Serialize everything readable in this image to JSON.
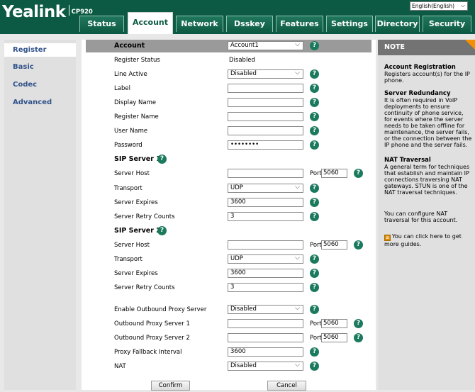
{
  "header": {
    "brand": "Yealink",
    "model": "CP920",
    "language": "English(English)"
  },
  "tabs": [
    "Status",
    "Account",
    "Network",
    "Dsskey",
    "Features",
    "Settings",
    "Directory",
    "Security"
  ],
  "active_tab": "Account",
  "sidebar": {
    "items": [
      {
        "label": "Register"
      },
      {
        "label": "Basic"
      },
      {
        "label": "Codec"
      },
      {
        "label": "Advanced"
      }
    ]
  },
  "form": {
    "account_label": "Account",
    "account_value": "Account1",
    "register_status_label": "Register Status",
    "register_status_value": "Disabled",
    "line_active_label": "Line Active",
    "line_active_value": "Disabled",
    "label_label": "Label",
    "label_value": "",
    "display_name_label": "Display Name",
    "display_name_value": "",
    "register_name_label": "Register Name",
    "register_name_value": "",
    "user_name_label": "User Name",
    "user_name_value": "",
    "password_label": "Password",
    "password_value": "••••••••",
    "sip_server_1": {
      "title": "SIP Server 1",
      "host_label": "Server Host",
      "host_value": "",
      "port_label": "Port",
      "port_value": "5060",
      "transport_label": "Transport",
      "transport_value": "UDP",
      "expires_label": "Server Expires",
      "expires_value": "3600",
      "retry_label": "Server Retry Counts",
      "retry_value": "3"
    },
    "sip_server_2": {
      "title": "SIP Server 2",
      "host_label": "Server Host",
      "host_value": "",
      "port_label": "Port",
      "port_value": "5060",
      "transport_label": "Transport",
      "transport_value": "UDP",
      "expires_label": "Server Expires",
      "expires_value": "3600",
      "retry_label": "Server Retry Counts",
      "retry_value": "3"
    },
    "outbound_proxy_label": "Enable Outbound Proxy Server",
    "outbound_proxy_value": "Disabled",
    "outbound_1_label": "Outbound Proxy Server 1",
    "outbound_1_value": "",
    "outbound_1_port_label": "Port",
    "outbound_1_port": "5060",
    "outbound_2_label": "Outbound Proxy Server 2",
    "outbound_2_value": "",
    "outbound_2_port_label": "Port",
    "outbound_2_port": "5060",
    "fallback_label": "Proxy Fallback Interval",
    "fallback_value": "3600",
    "nat_label": "NAT",
    "nat_value": "Disabled",
    "confirm_label": "Confirm",
    "cancel_label": "Cancel",
    "help_glyph": "?",
    "dropdown_glyph": "⌵"
  },
  "note": {
    "title": "NOTE",
    "blocks": [
      {
        "title": "Account Registration",
        "text": "Registers account(s) for the IP phone."
      },
      {
        "title": "Server Redundancy",
        "text": "It is often required in VoIP deployments to ensure continuity of phone service, for events where the server needs to be taken offline for maintenance, the server fails, or the connection between the IP phone and the server fails."
      },
      {
        "title": "NAT Traversal",
        "text": "A general term for techniques that establish and maintain IP connections traversing NAT gateways. STUN is one of the NAT traversal techniques."
      },
      {
        "title": "",
        "text": "You can configure NAT traversal for this account."
      }
    ],
    "guide_text": "You can click here to get more guides."
  },
  "colors": {
    "header_green": "#0c5a43",
    "help_green": "#1b7a5e",
    "nav_blue": "#31538a",
    "note_accent": "#f29000"
  }
}
